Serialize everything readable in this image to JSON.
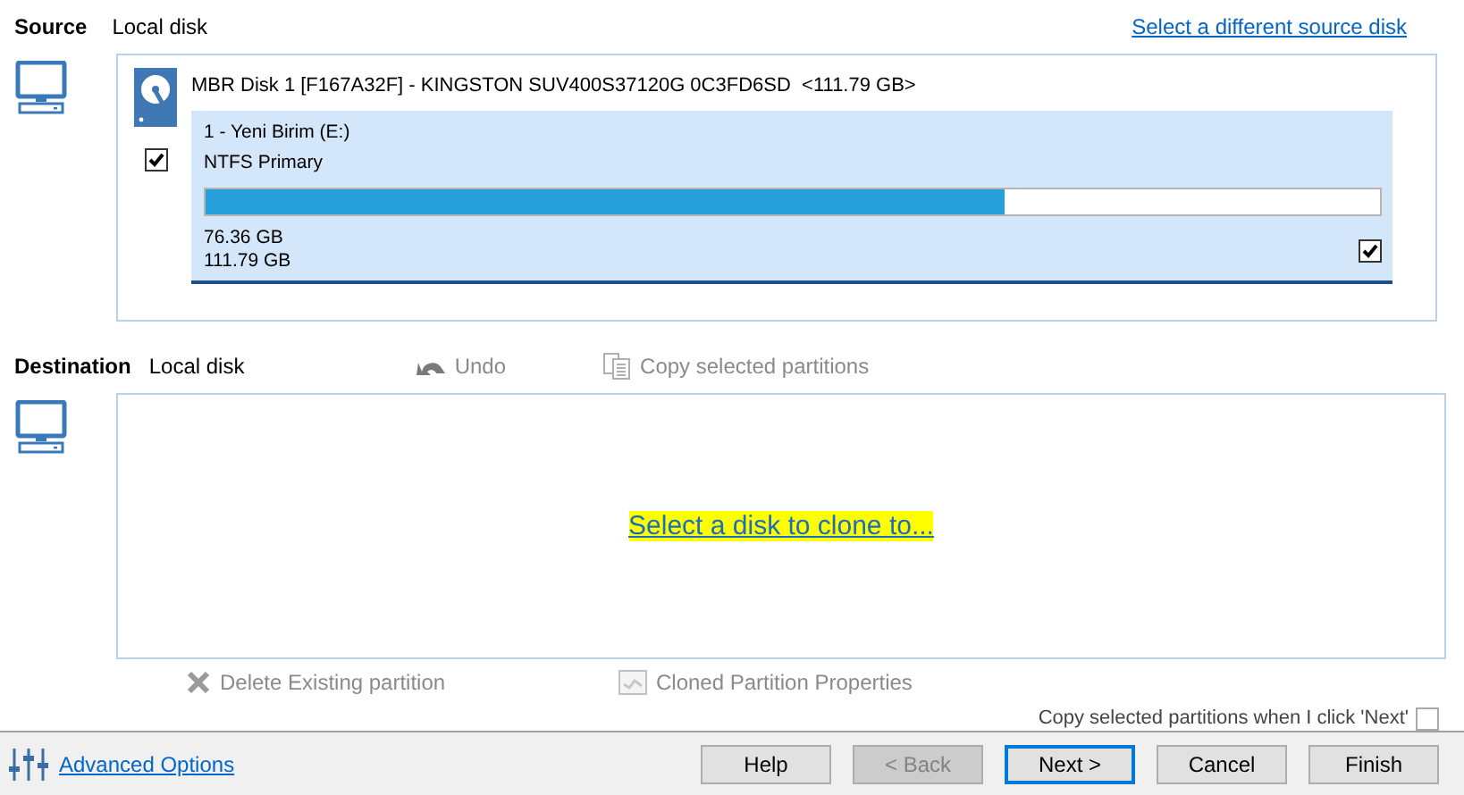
{
  "source": {
    "label": "Source",
    "disk_type": "Local disk",
    "change_link": "Select a different source disk",
    "disk": {
      "title": "MBR Disk 1 [F167A32F] - KINGSTON SUV400S37120G 0C3FD6SD  <111.79 GB>",
      "checked": true,
      "partition": {
        "name": "1 - Yeni Birim (E:)",
        "fs": "NTFS Primary",
        "level": 0.68,
        "used": "76.36 GB",
        "total": "111.79 GB",
        "checked": true
      }
    }
  },
  "destination": {
    "label": "Destination",
    "disk_type": "Local disk",
    "prompt": "Select a disk to clone to...",
    "tools": [
      {
        "kind": "undo",
        "label": "Undo",
        "disabled": true
      },
      {
        "kind": "copy",
        "label": "Copy selected partitions",
        "disabled": true
      }
    ]
  },
  "actions": [
    {
      "kind": "delete",
      "label": "Delete Existing partition",
      "disabled": true
    },
    {
      "kind": "properties",
      "label": "Cloned Partition Properties",
      "disabled": true
    }
  ],
  "copy_on_next": {
    "label": "Copy selected partitions when I click 'Next'",
    "checked": false
  },
  "footer": {
    "advanced": "Advanced Options",
    "buttons": [
      {
        "label": "Help",
        "disabled": false,
        "selected": false
      },
      {
        "label": "< Back",
        "disabled": true,
        "selected": false
      },
      {
        "label": "Next >",
        "disabled": false,
        "selected": true
      },
      {
        "label": "Cancel",
        "disabled": false,
        "selected": false
      },
      {
        "label": "Finish",
        "disabled": false,
        "selected": false
      }
    ]
  }
}
